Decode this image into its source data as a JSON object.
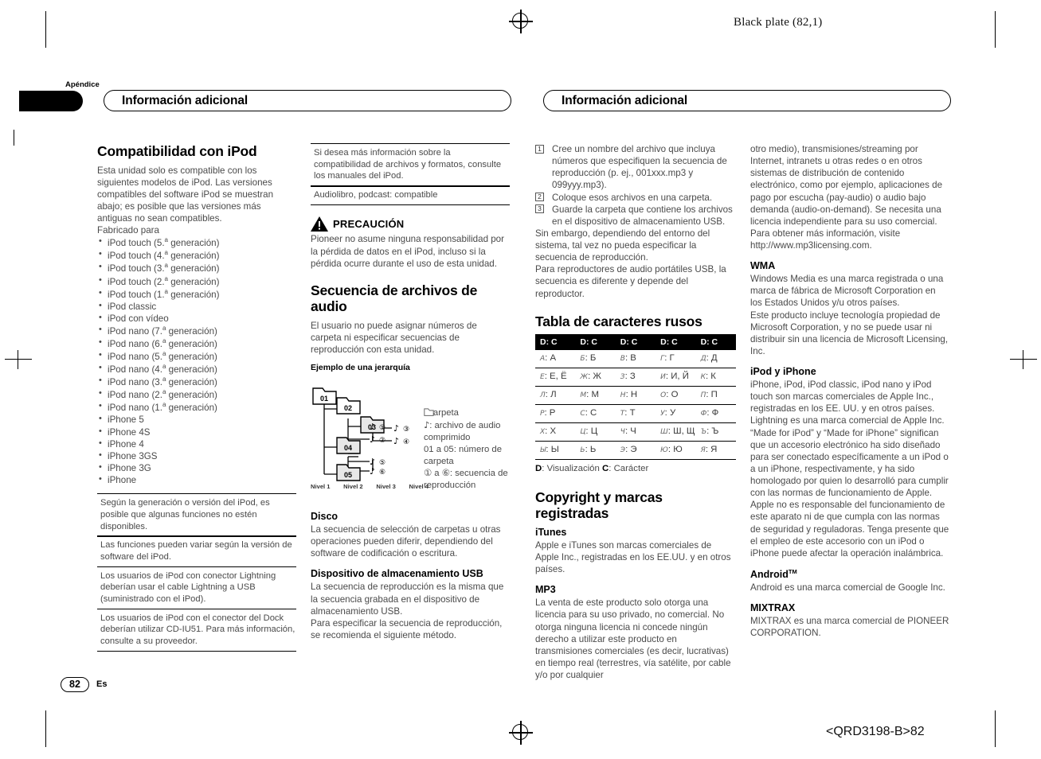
{
  "marks": {
    "black_plate": "Black plate (82,1)",
    "qrd_code": "<QRD3198-B>82",
    "qrd_prefix": "<",
    "apendice": "Apéndice",
    "page_number": "82",
    "page_language": "Es"
  },
  "header": {
    "left_title": "Información adicional",
    "right_title": "Información adicional"
  },
  "col1": {
    "heading": "Compatibilidad con iPod",
    "intro": "Esta unidad solo es compatible con los siguientes modelos de iPod. Las versiones compatibles del software iPod se muestran abajo; es posible que las versiones más antiguas no sean compatibles.",
    "fabricado": "Fabricado para",
    "models": [
      "iPod touch (5.ª generación)",
      "iPod touch (4.ª generación)",
      "iPod touch (3.ª generación)",
      "iPod touch (2.ª generación)",
      "iPod touch (1.ª generación)",
      "iPod classic",
      "iPod con vídeo",
      "iPod nano (7.ª generación)",
      "iPod nano (6.ª generación)",
      "iPod nano (5.ª generación)",
      "iPod nano (4.ª generación)",
      "iPod nano (3.ª generación)",
      "iPod nano (2.ª generación)",
      "iPod nano (1.ª generación)",
      "iPhone 5",
      "iPhone 4S",
      "iPhone 4",
      "iPhone 3GS",
      "iPhone 3G",
      "iPhone"
    ],
    "notes": [
      "Según la generación o versión del iPod, es posible que algunas funciones no estén disponibles.",
      "Las funciones pueden variar según la versión de software del iPod.",
      "Los usuarios de iPod con conector Lightning deberían usar el cable Lightning a USB (suministrado con el iPod).",
      "Los usuarios de iPod con el conector del Dock deberían utilizar CD-IU51. Para más información, consulte a su proveedor."
    ]
  },
  "col2": {
    "notes": [
      "Si desea más información sobre la compatibilidad de archivos y formatos, consulte los manuales del iPod.",
      "Audiolibro, podcast: compatible"
    ],
    "caution_title": "PRECAUCIÓN",
    "caution_body": "Pioneer no asume ninguna responsabilidad por la pérdida de datos en el iPod, incluso si la pérdida ocurre durante el uso de esta unidad.",
    "seq_heading": "Secuencia de archivos de audio",
    "seq_body": "El usuario no puede asignar números de carpeta ni especificar secuencias de reproducción con esta unidad.",
    "example_heading": "Ejemplo de una jerarquía",
    "folders": [
      "01",
      "02",
      "03",
      "04",
      "05"
    ],
    "levels": [
      "Nivel 1",
      "Nivel 2",
      "Nivel 3",
      "Nivel 4"
    ],
    "diagram_legend": [
      ": carpeta",
      ": archivo de audio comprimido",
      "01 a 05: número de carpeta",
      "① a ⑥: secuencia de reproducción"
    ],
    "disco_heading": "Disco",
    "disco_body": "La secuencia de selección de carpetas u otras operaciones pueden diferir, dependiendo del software de codificación o escritura.",
    "usb_heading": "Dispositivo de almacenamiento USB",
    "usb_body1": "La secuencia de reproducción es la misma que la secuencia grabada en el dispositivo de almacenamiento USB.",
    "usb_body2": "Para especificar la secuencia de reproducción, se recomienda el siguiente método."
  },
  "col3": {
    "steps": [
      {
        "n": "1",
        "text": "Cree un nombre del archivo que incluya números que especifiquen la secuencia de reproducción (p. ej., 001xxx.mp3 y 099yyy.mp3)."
      },
      {
        "n": "2",
        "text": "Coloque esos archivos en una carpeta."
      },
      {
        "n": "3",
        "text": "Guarde la carpeta que contiene los archivos en el dispositivo de almacenamiento USB."
      }
    ],
    "after_steps1": "Sin embargo, dependiendo del entorno del sistema, tal vez no pueda especificar la secuencia de reproducción.",
    "after_steps2": "Para reproductores de audio portátiles USB, la secuencia es diferente y depende del reproductor.",
    "rus_heading": "Tabla de caracteres rusos",
    "rus_col_header": "D: C",
    "rus_rows": [
      [
        {
          "d": "A",
          "c": "А"
        },
        {
          "d": "Б",
          "c": "Б"
        },
        {
          "d": "В",
          "c": "В"
        },
        {
          "d": "Г",
          "c": "Г"
        },
        {
          "d": "Д",
          "c": "Д"
        }
      ],
      [
        {
          "d": "Е",
          "c": "Е, Ё"
        },
        {
          "d": "Ж",
          "c": "Ж"
        },
        {
          "d": "З",
          "c": "З"
        },
        {
          "d": "И",
          "c": "И, Й"
        },
        {
          "d": "К",
          "c": "К"
        }
      ],
      [
        {
          "d": "Л",
          "c": "Л"
        },
        {
          "d": "М",
          "c": "М"
        },
        {
          "d": "Н",
          "c": "Н"
        },
        {
          "d": "О",
          "c": "О"
        },
        {
          "d": "П",
          "c": "П"
        }
      ],
      [
        {
          "d": "Р",
          "c": "Р"
        },
        {
          "d": "С",
          "c": "С"
        },
        {
          "d": "Т",
          "c": "Т"
        },
        {
          "d": "У",
          "c": "У"
        },
        {
          "d": "Ф",
          "c": "Ф"
        }
      ],
      [
        {
          "d": "Х",
          "c": "Х"
        },
        {
          "d": "Ц",
          "c": "Ц"
        },
        {
          "d": "Ч",
          "c": "Ч"
        },
        {
          "d": "Ш",
          "c": "Ш, Щ"
        },
        {
          "d": "Ъ",
          "c": "Ъ"
        }
      ],
      [
        {
          "d": "Ы",
          "c": "Ы"
        },
        {
          "d": "Ь",
          "c": "Ь"
        },
        {
          "d": "Э",
          "c": "Э"
        },
        {
          "d": "Ю",
          "c": "Ю"
        },
        {
          "d": "Я",
          "c": "Я"
        }
      ]
    ],
    "rus_legend_d": "D",
    "rus_legend_d_text": ": Visualización ",
    "rus_legend_c": "C",
    "rus_legend_c_text": ": Carácter",
    "copyright_heading": "Copyright y marcas registradas",
    "itunes_heading": "iTunes",
    "itunes_body": "Apple e iTunes son marcas comerciales de Apple Inc., registradas en los EE.UU. y en otros países.",
    "mp3_heading": "MP3",
    "mp3_body": "La venta de este producto solo otorga una licencia para su uso privado, no comercial. No otorga ninguna licencia ni concede ningún derecho a utilizar este producto en transmisiones comerciales (es decir, lucrativas) en tiempo real (terrestres, vía satélite, por cable y/o por cualquier"
  },
  "col4": {
    "mp3_cont": "otro medio), transmisiones/streaming por Internet, intranets u otras redes o en otros sistemas de distribución de contenido electrónico, como por ejemplo, aplicaciones de pago por escucha (pay-audio) o audio bajo demanda (audio-on-demand). Se necesita una licencia independiente para su uso comercial. Para obtener más información, visite",
    "mp3_url": "http://www.mp3licensing.com.",
    "wma_heading": "WMA",
    "wma_body": "Windows Media es una marca registrada o una marca de fábrica de Microsoft Corporation en los Estados Unidos y/u otros países.\nEste producto incluye tecnología propiedad de Microsoft Corporation, y no se puede usar ni distribuir sin una licencia de Microsoft Licensing, Inc.",
    "ipod_heading": "iPod y iPhone",
    "ipod_body": "iPhone, iPod, iPod classic, iPod nano y iPod touch son marcas comerciales de Apple Inc., registradas en los EE. UU. y en otros países. Lightning es una marca comercial de Apple Inc. “Made for iPod” y “Made for iPhone” significan que un accesorio electrónico ha sido diseñado para ser conectado específicamente a un iPod o a un iPhone, respectivamente, y ha sido homologado por quien lo desarrolló para cumplir con las normas de funcionamiento de Apple. Apple no es responsable del funcionamiento de este aparato ni de que cumpla con las normas de seguridad y reguladoras. Tenga presente que el empleo de este accesorio con un iPod o iPhone puede afectar la operación inalámbrica.",
    "android_heading": "Android",
    "android_tm": "TM",
    "android_body": "Android es una marca comercial de Google Inc.",
    "mixtrax_heading": "MIXTRAX",
    "mixtrax_body": "MIXTRAX es una marca comercial de PIONEER CORPORATION."
  }
}
